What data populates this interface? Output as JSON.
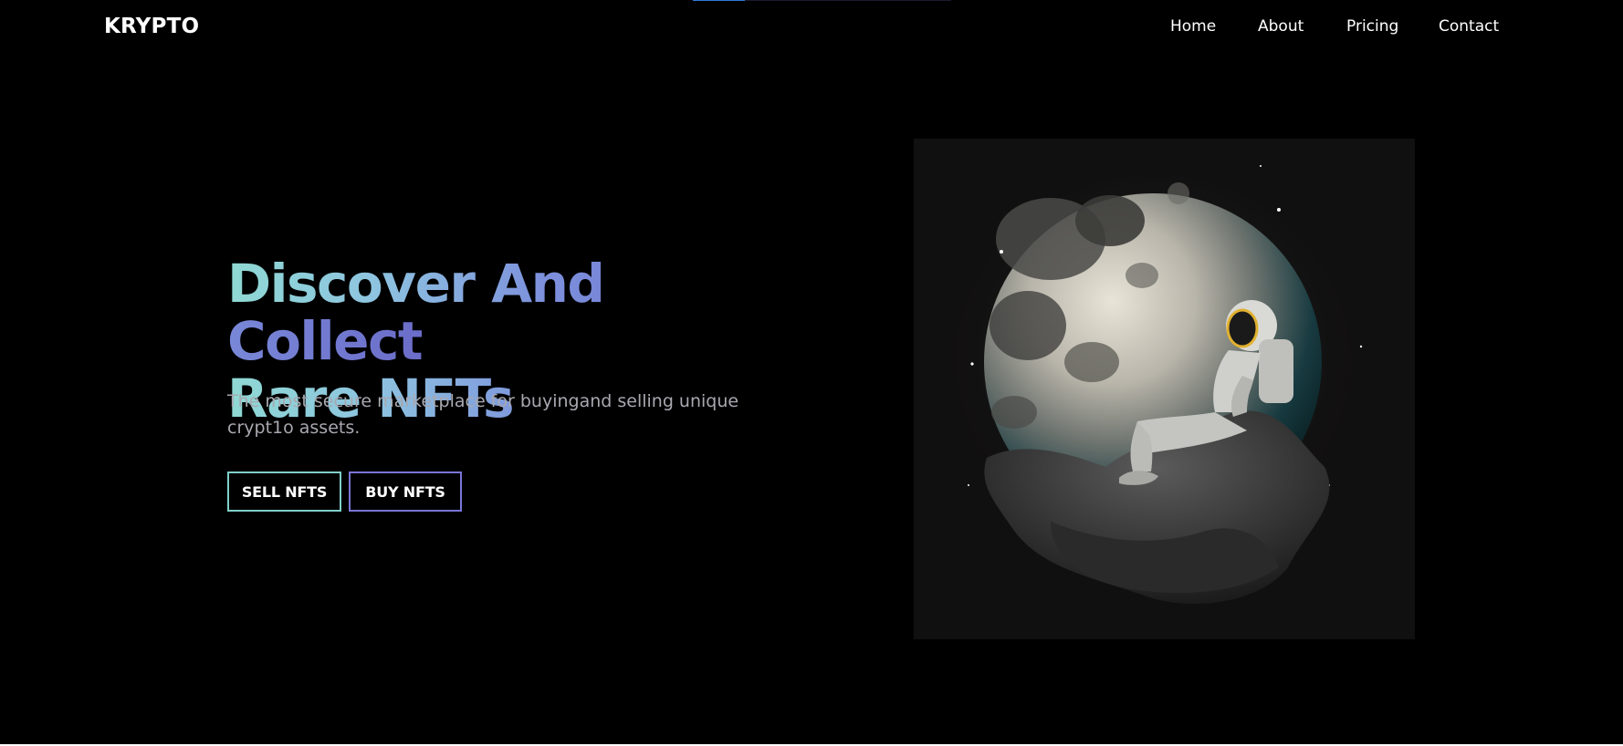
{
  "header": {
    "logo": "KRYPTO",
    "nav": [
      {
        "label": "Home"
      },
      {
        "label": "About"
      },
      {
        "label": "Pricing"
      },
      {
        "label": "Contact"
      }
    ],
    "progress_fraction": 0.2
  },
  "hero": {
    "title_line1": "Discover And Collect",
    "title_line2": "Rare NFTs",
    "subtitle": "The most secure marketplace for buyingand selling unique crypt1o assets.",
    "sell_button": "SELL NFTS",
    "buy_button": "BUY NFTS",
    "image_icon": "astronaut-moon-illustration"
  },
  "colors": {
    "background": "#000000",
    "gradient_start": "#8fd9d3",
    "gradient_end": "#6a6bc8",
    "sell_border": "#7fcfc9",
    "buy_border": "#7a75d6",
    "subtitle": "#a8a8b0",
    "progress": "#2f7bd8"
  }
}
